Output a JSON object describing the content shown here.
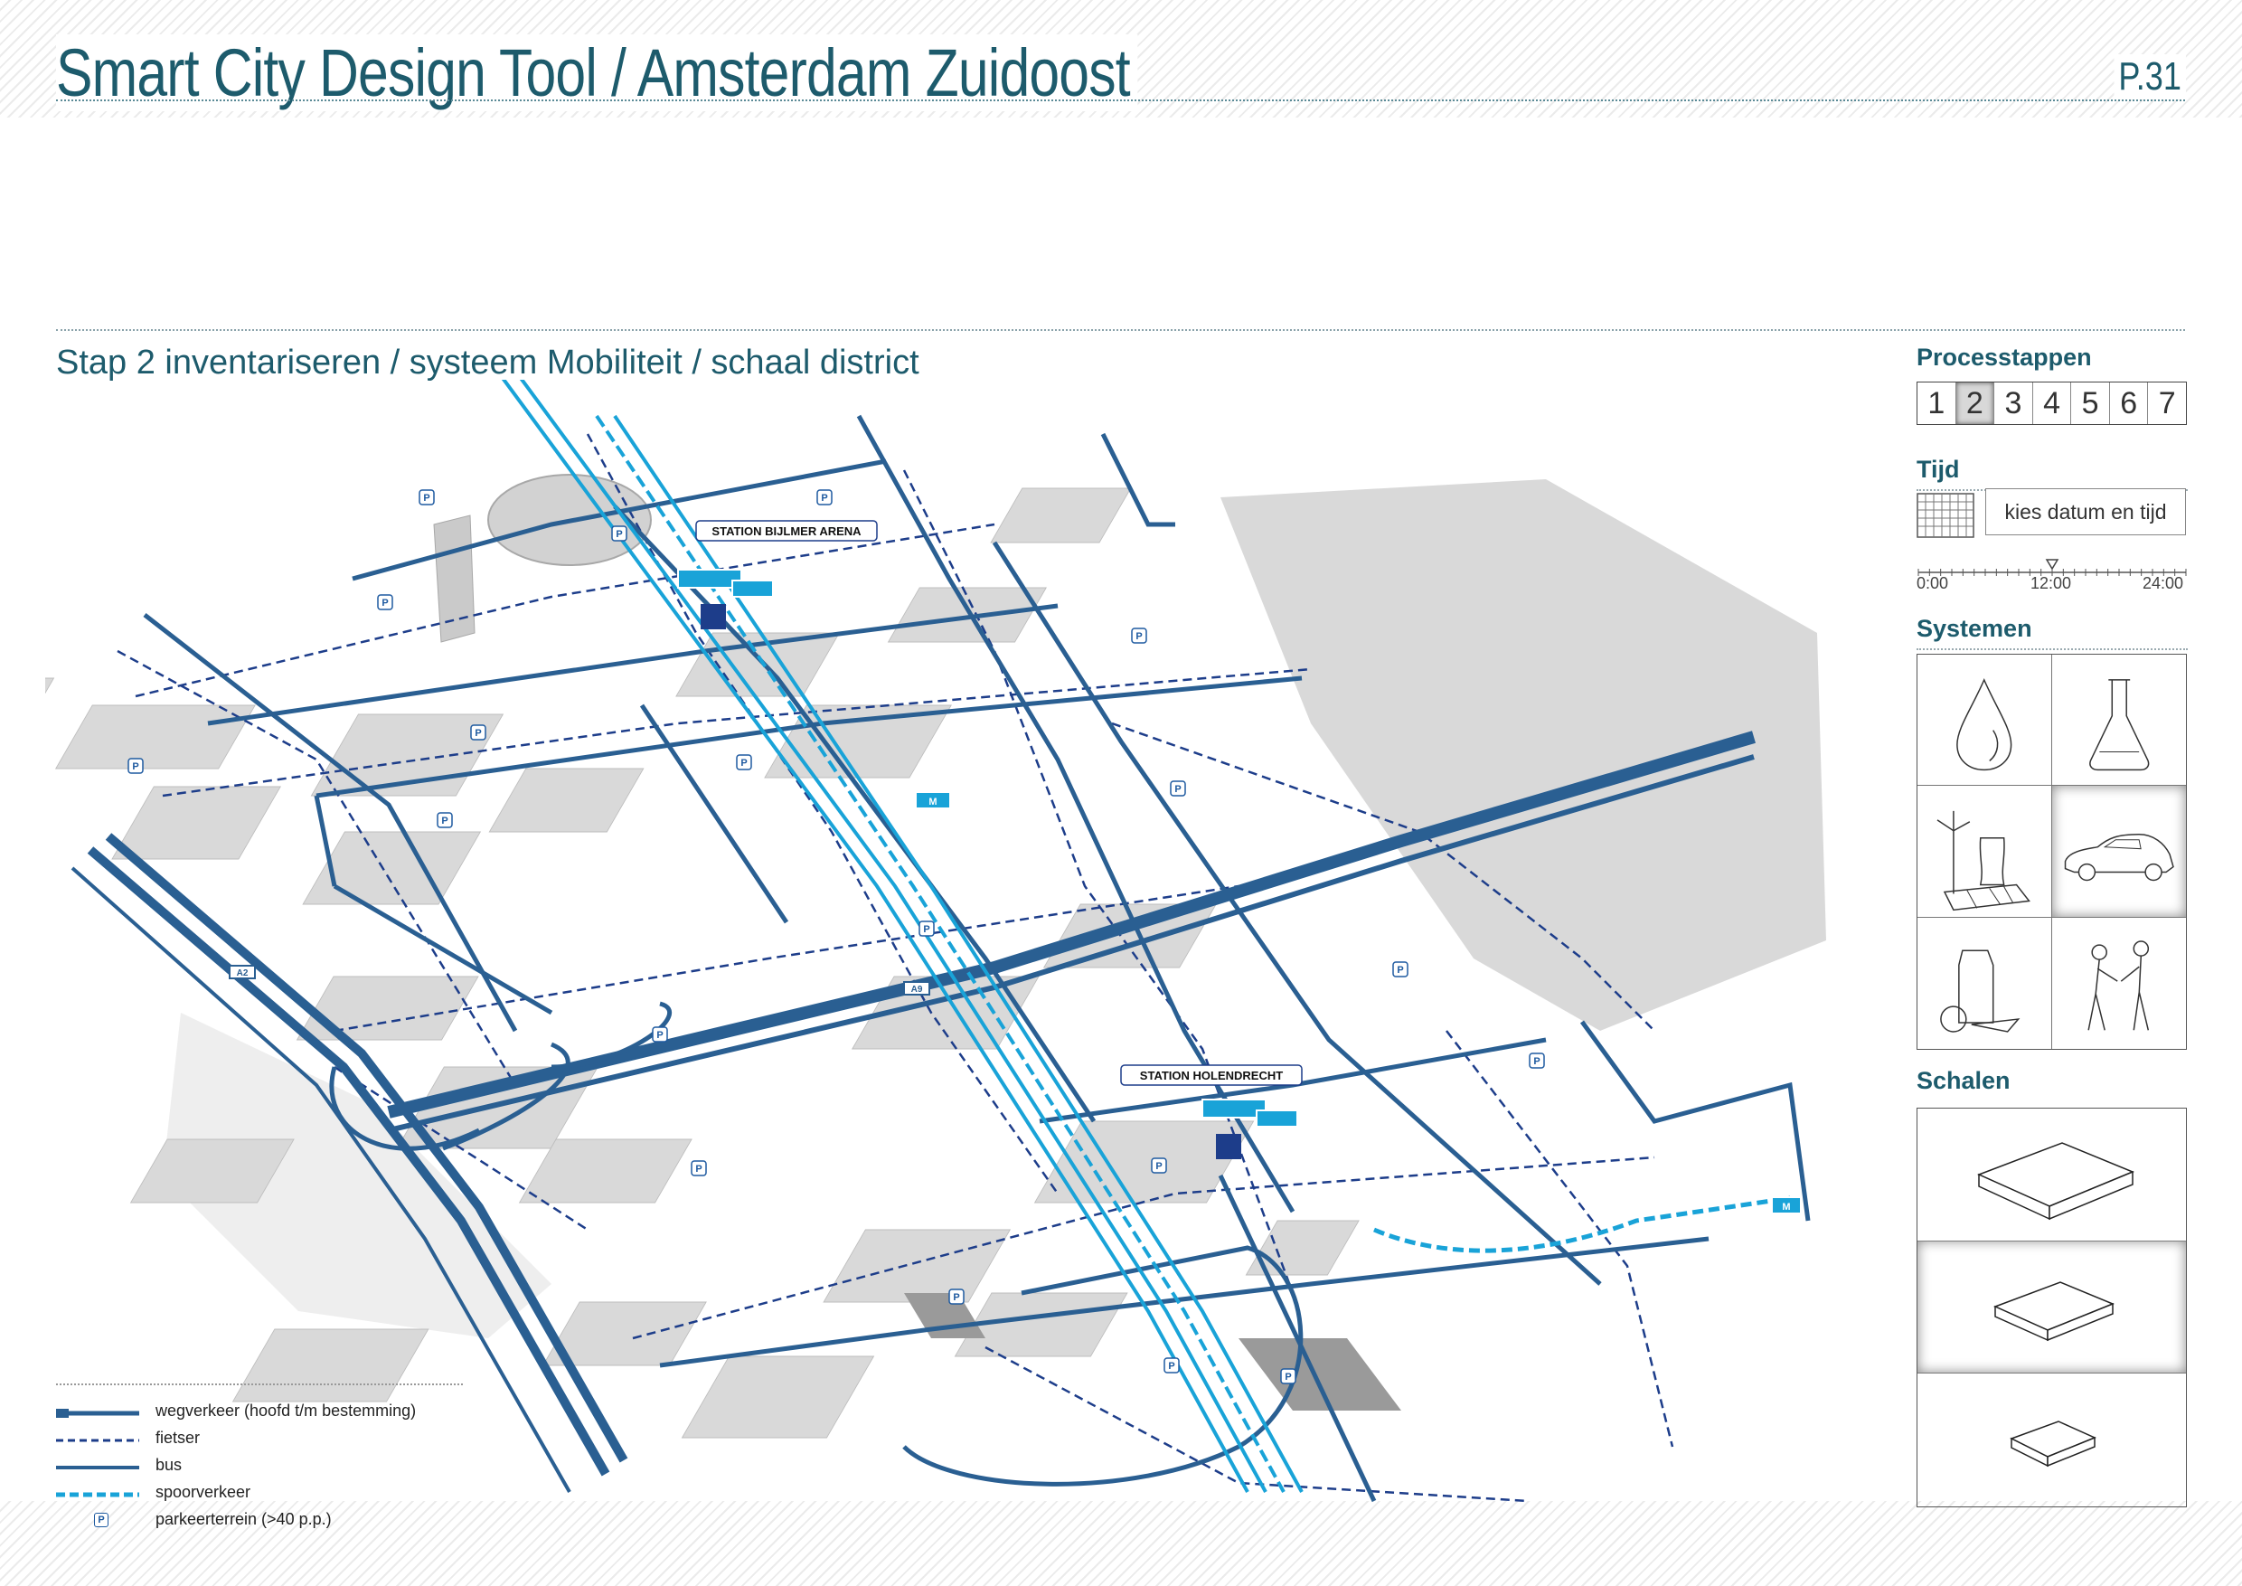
{
  "header": {
    "title": "Smart City Design Tool / Amsterdam Zuidoost",
    "page_number": "P.31"
  },
  "subtitle": "Stap 2 inventariseren / systeem Mobiliteit / schaal district",
  "map": {
    "stations": [
      {
        "label": "STATION BIJLMER ARENA"
      },
      {
        "label": "STATION HOLENDRECHT"
      }
    ],
    "highway_labels": [
      "A2",
      "A9"
    ],
    "parking_symbol": "P",
    "metro_symbol": "M",
    "colors": {
      "road": "#2a5f92",
      "bike": "#1d3d8a",
      "bus": "#2a5f92",
      "rail": "#19a3d8",
      "buildings": "#d6d6d6",
      "water": "#d9d9d9"
    }
  },
  "legend": [
    {
      "key": "road",
      "label": "wegverkeer (hoofd t/m bestemming)"
    },
    {
      "key": "bike",
      "label": "fietser"
    },
    {
      "key": "bus",
      "label": "bus"
    },
    {
      "key": "rail",
      "label": "spoorverkeer"
    },
    {
      "key": "parking",
      "label": "parkeerterrein (>40 p.p.)"
    }
  ],
  "panel": {
    "process_heading": "Processtappen",
    "steps": [
      "1",
      "2",
      "3",
      "4",
      "5",
      "6",
      "7"
    ],
    "active_step": "2",
    "time_heading": "Tijd",
    "date_field": "kies datum en tijd",
    "timeline_labels": [
      "0:00",
      "12:00",
      "24:00"
    ],
    "systems_heading": "Systemen",
    "systems": [
      {
        "icon": "water-drop-icon"
      },
      {
        "icon": "flask-icon"
      },
      {
        "icon": "energy-icon"
      },
      {
        "icon": "car-icon",
        "active": true
      },
      {
        "icon": "food-icon"
      },
      {
        "icon": "people-icon"
      }
    ],
    "scales_heading": "Schalen",
    "scales": [
      {
        "icon": "scale-large-icon"
      },
      {
        "icon": "scale-medium-icon",
        "active": true
      },
      {
        "icon": "scale-small-icon"
      }
    ]
  }
}
